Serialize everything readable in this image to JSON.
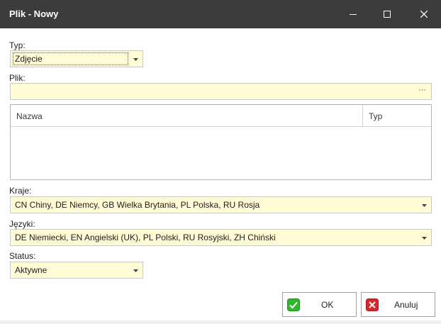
{
  "window": {
    "title": "Plik - Nowy"
  },
  "form": {
    "typ": {
      "label": "Typ:",
      "value": "Zdjęcie"
    },
    "plik": {
      "label": "Plik:",
      "value": "",
      "browse": "···"
    },
    "grid": {
      "columns": [
        "Nazwa",
        "Typ"
      ],
      "rows": []
    },
    "kraje": {
      "label": "Kraje:",
      "value": "CN Chiny, DE Niemcy, GB Wielka Brytania, PL Polska, RU Rosja"
    },
    "jezyki": {
      "label": "Języki:",
      "value": "DE Niemiecki, EN Angielski (UK), PL Polski, RU Rosyjski, ZH Chiński"
    },
    "status": {
      "label": "Status:",
      "value": "Aktywne"
    }
  },
  "buttons": {
    "ok": "OK",
    "cancel": "Anuluj"
  },
  "icons": {
    "minimize": "minimize-icon",
    "maximize": "maximize-icon",
    "close": "close-icon",
    "ok": "check-icon",
    "cancel": "x-icon",
    "dropdown": "chevron-down-icon"
  },
  "colors": {
    "titlebar": "#3c3c3c",
    "field": "#fffbd5",
    "ok_icon": "#2eb82e",
    "cancel_icon": "#d9262c"
  }
}
